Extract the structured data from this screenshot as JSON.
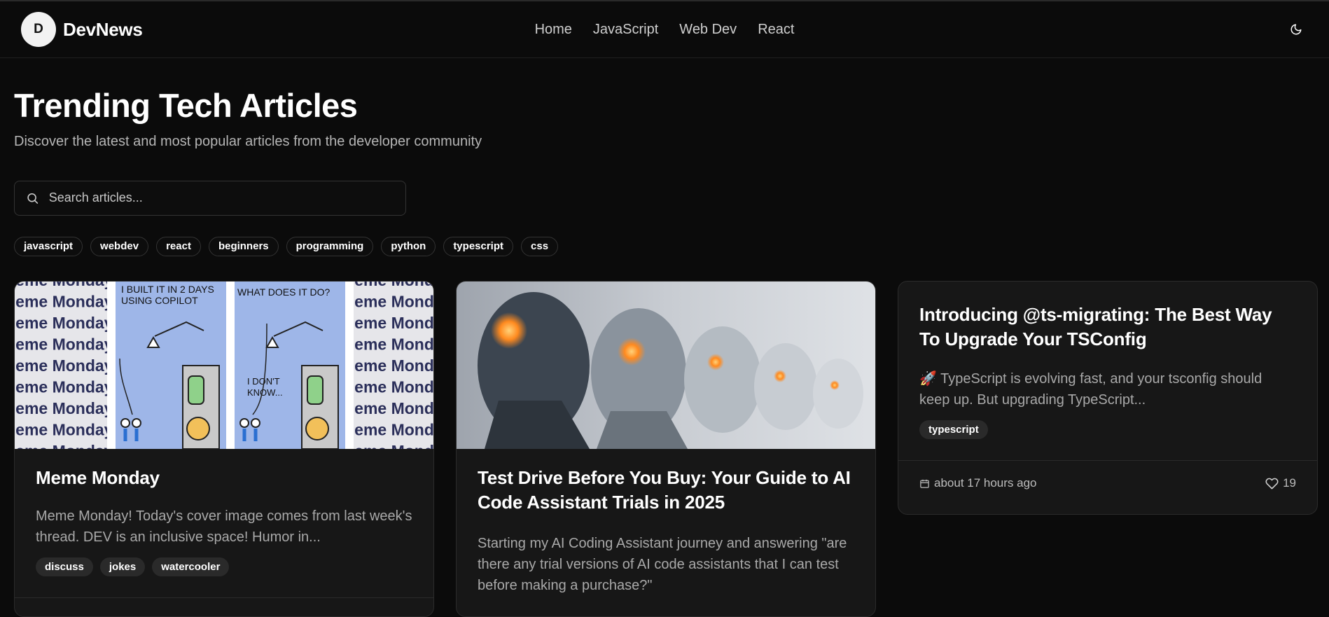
{
  "app": {
    "logo_letter": "D",
    "name": "DevNews"
  },
  "nav": [
    "Home",
    "JavaScript",
    "Web Dev",
    "React"
  ],
  "hero": {
    "title": "Trending Tech Articles",
    "subtitle": "Discover the latest and most popular articles from the developer community"
  },
  "search": {
    "placeholder": "Search articles..."
  },
  "tags": [
    "javascript",
    "webdev",
    "react",
    "beginners",
    "programming",
    "python",
    "typescript",
    "css"
  ],
  "articles": [
    {
      "title": "Meme Monday",
      "excerpt": "Meme Monday! Today's cover image comes from last week's thread. DEV is an inclusive space! Humor in...",
      "tags": [
        "discuss",
        "jokes",
        "watercooler"
      ],
      "cover": {
        "pattern_text": "Meme Monday",
        "panel1_caption": "I BUILT IT IN 2 DAYS USING COPILOT",
        "panel2_caption": "WHAT DOES IT DO?",
        "panel2_reply": "I DON'T KNOW..."
      }
    },
    {
      "title": "Test Drive Before You Buy: Your Guide to AI Code Assistant Trials in 2025",
      "excerpt": "Starting my AI Coding Assistant journey and answering \"are there any trial versions of AI code assistants that I can test before making a purchase?\"",
      "tags": []
    },
    {
      "title": "Introducing @ts-migrating: The Best Way To Upgrade Your TSConfig",
      "excerpt": "🚀 TypeScript is evolving fast, and your tsconfig should keep up. But upgrading TypeScript...",
      "tags": [
        "typescript"
      ],
      "date": "about 17 hours ago",
      "likes": "19"
    }
  ],
  "colors": {
    "background": "#0b0b0b",
    "card": "#171717",
    "border": "#2b2b2b",
    "muted_text": "#a9a9a9"
  }
}
